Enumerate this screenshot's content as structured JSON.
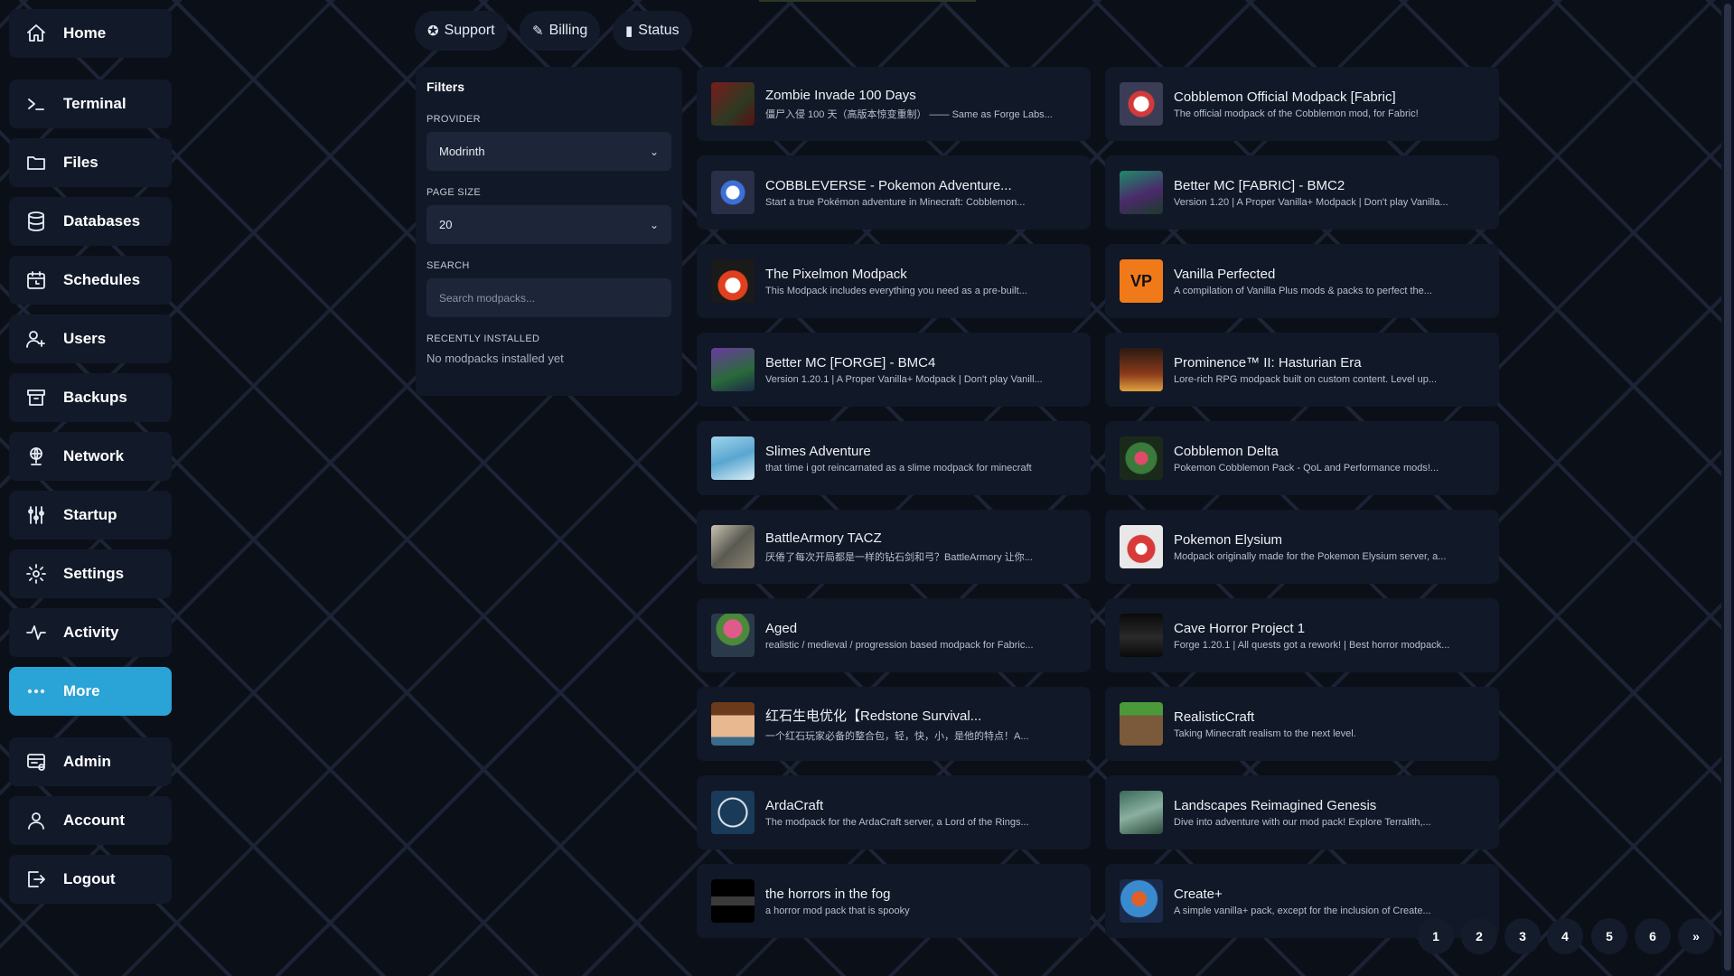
{
  "sidebar": {
    "items": [
      {
        "label": "Home",
        "icon": "home-icon"
      },
      {
        "label": "Terminal",
        "icon": "terminal-icon"
      },
      {
        "label": "Files",
        "icon": "folder-icon"
      },
      {
        "label": "Databases",
        "icon": "database-icon"
      },
      {
        "label": "Schedules",
        "icon": "calendar-icon"
      },
      {
        "label": "Users",
        "icon": "users-icon"
      },
      {
        "label": "Backups",
        "icon": "archive-icon"
      },
      {
        "label": "Network",
        "icon": "network-icon"
      },
      {
        "label": "Startup",
        "icon": "sliders-icon"
      },
      {
        "label": "Settings",
        "icon": "gear-icon"
      },
      {
        "label": "Activity",
        "icon": "activity-icon"
      },
      {
        "label": "More",
        "icon": "dots-icon",
        "active": true
      },
      {
        "label": "Admin",
        "icon": "admin-icon"
      },
      {
        "label": "Account",
        "icon": "user-icon"
      },
      {
        "label": "Logout",
        "icon": "logout-icon"
      }
    ]
  },
  "top_links": {
    "support": "Support",
    "billing": "Billing",
    "status": "Status"
  },
  "filters": {
    "title": "Filters",
    "provider_label": "PROVIDER",
    "provider_value": "Modrinth",
    "page_size_label": "PAGE SIZE",
    "page_size_value": "20",
    "search_label": "SEARCH",
    "search_placeholder": "Search modpacks...",
    "recent_label": "RECENTLY INSTALLED",
    "recent_value": "No modpacks installed yet"
  },
  "modpacks": [
    {
      "title": "Zombie Invade 100 Days",
      "desc": "僵尸入侵 100 天（高版本惊变重制） —— Same as Forge Labs..."
    },
    {
      "title": "Cobblemon Official Modpack [Fabric]",
      "desc": "The official modpack of the Cobblemon mod, for Fabric!"
    },
    {
      "title": "COBBLEVERSE - Pokemon Adventure...",
      "desc": "Start a true Pokémon adventure in Minecraft: Cobblemon..."
    },
    {
      "title": "Better MC [FABRIC] - BMC2",
      "desc": "Version 1.20 | A Proper Vanilla+ Modpack | Don't play Vanilla..."
    },
    {
      "title": "The Pixelmon Modpack",
      "desc": "This Modpack includes everything you need as a pre-built..."
    },
    {
      "title": "Vanilla Perfected",
      "desc": "A compilation of Vanilla Plus mods & packs to perfect the..."
    },
    {
      "title": "Better MC [FORGE] - BMC4",
      "desc": "Version 1.20.1 | A Proper Vanilla+ Modpack | Don't play Vanill..."
    },
    {
      "title": "Prominence™ II: Hasturian Era",
      "desc": "Lore-rich RPG modpack built on custom content. Level up..."
    },
    {
      "title": "Slimes Adventure",
      "desc": "that time i got reincarnated as a slime modpack for minecraft"
    },
    {
      "title": "Cobblemon Delta",
      "desc": "Pokemon Cobblemon Pack - QoL and Performance mods!..."
    },
    {
      "title": "BattleArmory TACZ",
      "desc": "厌倦了每次开局都是一样的钻石剑和弓？BattleArmory 让你..."
    },
    {
      "title": "Pokemon Elysium",
      "desc": "Modpack originally made for the Pokemon Elysium server, a..."
    },
    {
      "title": "Aged",
      "desc": "realistic / medieval / progression based modpack for Fabric..."
    },
    {
      "title": "Cave Horror Project 1",
      "desc": "Forge 1.20.1 | All quests got a rework! | Best horror modpack..."
    },
    {
      "title": "红石生电优化【Redstone Survival...",
      "desc": "一个红石玩家必备的整合包，轻，快，小，是他的特点！A..."
    },
    {
      "title": "RealisticCraft",
      "desc": "Taking Minecraft realism to the next level."
    },
    {
      "title": "ArdaCraft",
      "desc": "The modpack for the ArdaCraft server, a Lord of the Rings..."
    },
    {
      "title": "Landscapes Reimagined Genesis",
      "desc": "Dive into adventure with our mod pack! Explore Terralith,..."
    },
    {
      "title": "the horrors in the fog",
      "desc": "a horror mod pack that is spooky"
    },
    {
      "title": "Create+",
      "desc": "A simple vanilla+ pack, except for the inclusion of Create..."
    }
  ],
  "pagination": {
    "pages": [
      "1",
      "2",
      "3",
      "4",
      "5",
      "6"
    ],
    "next": "»"
  },
  "colors": {
    "accent": "#2aa3d6",
    "panel": "#111827",
    "background": "#0b0f18"
  }
}
